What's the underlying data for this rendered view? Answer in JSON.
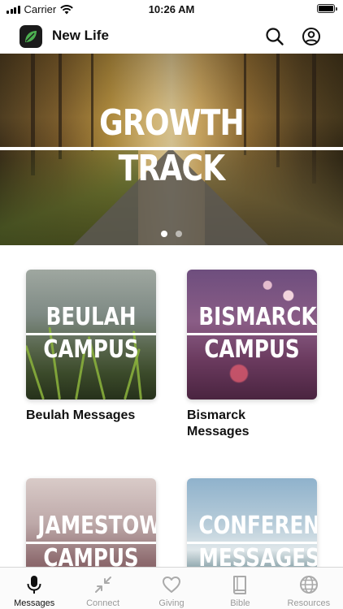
{
  "status_bar": {
    "carrier": "Carrier",
    "time": "10:26 AM"
  },
  "header": {
    "title": "New Life",
    "icons": [
      "leaf-logo-icon",
      "search-icon",
      "account-icon"
    ]
  },
  "hero": {
    "line1": "GROWTH",
    "line2": "TRACK",
    "pagination": {
      "total": 2,
      "active": 1
    }
  },
  "cards": [
    {
      "image_line1": "BEULAH",
      "image_line2": "CAMPUS",
      "label": "Beulah Messages"
    },
    {
      "image_line1": "BISMARCK",
      "image_line2": "CAMPUS",
      "label": "Bismarck Messages"
    },
    {
      "image_line1": "JAMESTOWN",
      "image_line2": "CAMPUS",
      "label": ""
    },
    {
      "image_line1": "CONFERENCE",
      "image_line2": "MESSAGES",
      "label": ""
    }
  ],
  "tabs": [
    {
      "label": "Messages",
      "icon": "microphone-icon",
      "active": true
    },
    {
      "label": "Connect",
      "icon": "compress-arrows-icon",
      "active": false
    },
    {
      "label": "Giving",
      "icon": "heart-icon",
      "active": false
    },
    {
      "label": "Bible",
      "icon": "book-icon",
      "active": false
    },
    {
      "label": "Resources",
      "icon": "globe-icon",
      "active": false
    }
  ],
  "colors": {
    "active_tab": "#111111",
    "inactive_tab": "#9a9a9a",
    "logo_leaf": "#4caf50"
  }
}
